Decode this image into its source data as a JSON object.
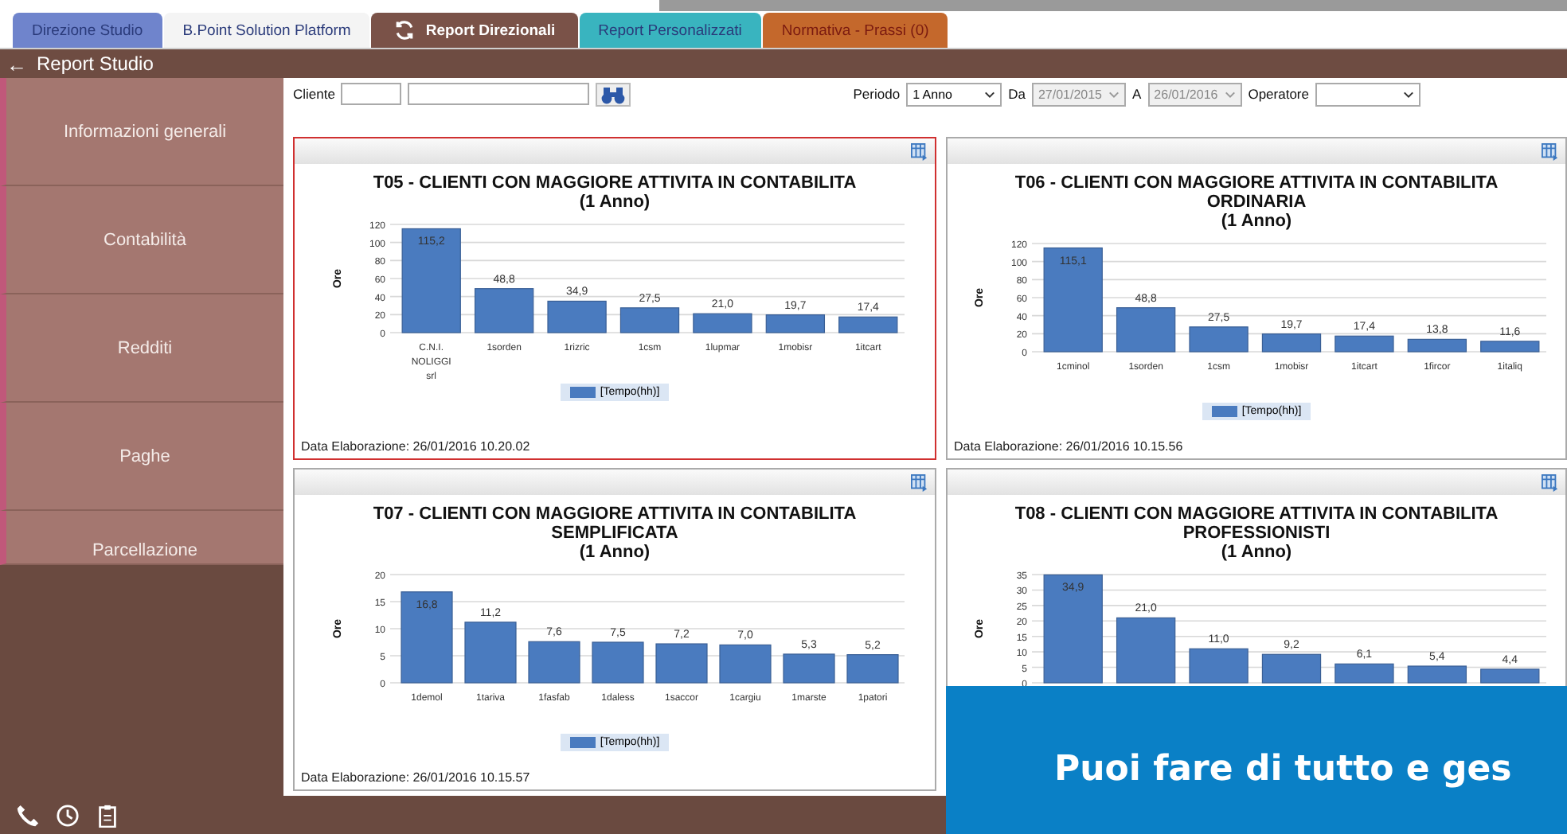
{
  "tabs": [
    {
      "label": "Direzione Studio",
      "selected": false,
      "color": "#6f84cc",
      "kind": "plain"
    },
    {
      "label": "B.Point Solution Platform",
      "selected": false,
      "color": "#f4f4f4",
      "kind": "plain"
    },
    {
      "label": "Report Direzionali",
      "selected": true,
      "color": "#7a5248",
      "kind": "refresh"
    },
    {
      "label": "Report Personalizzati",
      "selected": false,
      "color": "#39b4bf",
      "kind": "plain"
    },
    {
      "label": "Normativa - Prassi (0)",
      "selected": false,
      "color": "#c4682c",
      "kind": "plain"
    }
  ],
  "header": {
    "title": "Report Studio"
  },
  "sidebar": {
    "items": [
      {
        "label": "Informazioni generali",
        "selected": false
      },
      {
        "label": "Contabilità",
        "selected": false
      },
      {
        "label": "Redditi",
        "selected": false
      },
      {
        "label": "Paghe",
        "selected": false
      },
      {
        "label": "Parcellazione",
        "selected": false
      }
    ]
  },
  "filters": {
    "cliente_label": "Cliente",
    "periodo_label": "Periodo",
    "periodo_value": "1 Anno",
    "da_label": "Da",
    "da_value": "27/01/2015",
    "a_label": "A",
    "a_value": "26/01/2016",
    "operatore_label": "Operatore"
  },
  "panels": [
    {
      "selected": true,
      "period": "(1 Anno)",
      "footer": "Data Elaborazione:  26/01/2016 10.20.02",
      "chart_data": {
        "type": "bar",
        "grid": true,
        "title": "T05 - CLIENTI CON MAGGIORE ATTIVITA IN CONTABILITA",
        "ylabel": "Ore",
        "categories": [
          "C.N.I. NOLIGGI srl",
          "1sorden",
          "1rizric",
          "1csm",
          "1lupmar",
          "1mobisr",
          "1itcart"
        ],
        "series": [
          {
            "name": "[Tempo(hh)]",
            "color": "#4a7bbf",
            "values": [
              115.2,
              48.8,
              34.9,
              27.5,
              21.0,
              19.7,
              17.4
            ]
          }
        ],
        "value_labels": [
          "115,2",
          "48,8",
          "34,9",
          "27,5",
          "21,0",
          "19,7",
          "17,4"
        ],
        "ylim": [
          0,
          120
        ],
        "yticks": [
          0,
          20,
          40,
          60,
          80,
          100,
          120
        ]
      }
    },
    {
      "selected": false,
      "period": "(1 Anno)",
      "footer": "Data Elaborazione:  26/01/2016 10.15.56",
      "chart_data": {
        "type": "bar",
        "grid": true,
        "title": "T06 - CLIENTI CON MAGGIORE ATTIVITA IN CONTABILITA ORDINARIA",
        "ylabel": "Ore",
        "categories": [
          "1cminol",
          "1sorden",
          "1csm",
          "1mobisr",
          "1itcart",
          "1fircor",
          "1italiq"
        ],
        "series": [
          {
            "name": "[Tempo(hh)]",
            "color": "#4a7bbf",
            "values": [
              115.1,
              48.8,
              27.5,
              19.7,
              17.4,
              13.8,
              11.6
            ]
          }
        ],
        "value_labels": [
          "115,1",
          "48,8",
          "27,5",
          "19,7",
          "17,4",
          "13,8",
          "11,6"
        ],
        "ylim": [
          0,
          120
        ],
        "yticks": [
          0,
          20,
          40,
          60,
          80,
          100,
          120
        ]
      }
    },
    {
      "selected": false,
      "period": "(1 Anno)",
      "footer": "Data Elaborazione:  26/01/2016 10.15.57",
      "chart_data": {
        "type": "bar",
        "grid": true,
        "title": "T07 - CLIENTI CON MAGGIORE ATTIVITA IN CONTABILITA SEMPLIFICATA",
        "ylabel": "Ore",
        "categories": [
          "1demol",
          "1tariva",
          "1fasfab",
          "1daless",
          "1saccor",
          "1cargiu",
          "1marste",
          "1patori"
        ],
        "series": [
          {
            "name": "[Tempo(hh)]",
            "color": "#4a7bbf",
            "values": [
              16.8,
              11.2,
              7.6,
              7.5,
              7.2,
              7.0,
              5.3,
              5.2
            ]
          }
        ],
        "value_labels": [
          "16,8",
          "11,2",
          "7,6",
          "7,5",
          "7,2",
          "7,0",
          "5,3",
          "5,2"
        ],
        "ylim": [
          0,
          20
        ],
        "yticks": [
          0,
          5,
          10,
          15,
          20
        ]
      }
    },
    {
      "selected": false,
      "period": "(1 Anno)",
      "chart_data": {
        "type": "bar",
        "grid": true,
        "title": "T08 - CLIENTI CON MAGGIORE ATTIVITA IN CONTABILITA PROFESSIONISTI",
        "ylabel": "Ore",
        "series": [
          {
            "color": "#4a7bbf",
            "values": [
              34.9,
              21.0,
              11.0,
              9.2,
              6.1,
              5.4,
              4.4
            ]
          }
        ],
        "value_labels": [
          "34,9",
          "21,0",
          "11,0",
          "9,2",
          "6,1",
          "5,4",
          "4,4"
        ],
        "ylim": [
          0,
          35
        ],
        "yticks": [
          0,
          5,
          10,
          15,
          20,
          25,
          30,
          35
        ]
      }
    }
  ],
  "header_back": "←",
  "banner": {
    "text": "Puoi fare di tutto e ges"
  }
}
